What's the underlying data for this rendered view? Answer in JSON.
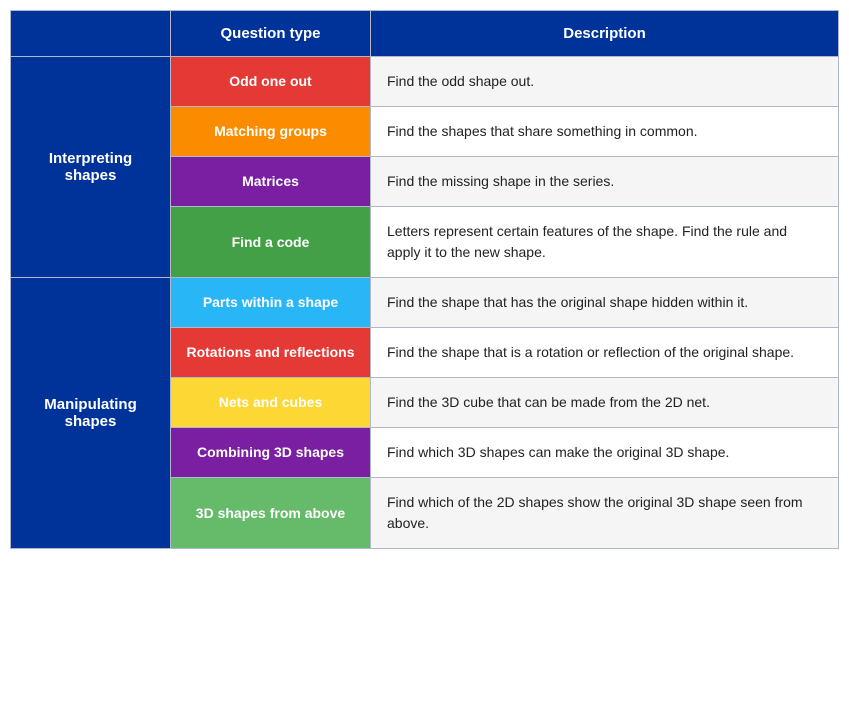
{
  "header": {
    "col1": "",
    "col2": "Question type",
    "col3": "Description"
  },
  "sections": [
    {
      "section_label": "Interpreting shapes",
      "section_rowspan": 4,
      "rows": [
        {
          "question_type": "Odd one out",
          "bg_class": "bg-red",
          "description": "Find the odd shape out.",
          "desc_alt": false
        },
        {
          "question_type": "Matching groups",
          "bg_class": "bg-orange",
          "description": "Find the shapes that share something in common.",
          "desc_alt": true
        },
        {
          "question_type": "Matrices",
          "bg_class": "bg-purple",
          "description": "Find the missing shape in the series.",
          "desc_alt": false
        },
        {
          "question_type": "Find a code",
          "bg_class": "bg-green-dark",
          "description": "Letters represent certain features of the shape. Find the rule and apply it to the new shape.",
          "desc_alt": true
        }
      ]
    },
    {
      "section_label": "Manipulating shapes",
      "section_rowspan": 5,
      "rows": [
        {
          "question_type": "Parts within a shape",
          "bg_class": "bg-cyan",
          "description": "Find the shape that has the original shape hidden within it.",
          "desc_alt": false
        },
        {
          "question_type": "Rotations and reflections",
          "bg_class": "bg-red2",
          "description": "Find the shape that is a rotation or reflection of the original shape.",
          "desc_alt": true
        },
        {
          "question_type": "Nets and cubes",
          "bg_class": "bg-yellow",
          "description": "Find the 3D cube that can be made from the 2D net.",
          "desc_alt": false
        },
        {
          "question_type": "Combining 3D shapes",
          "bg_class": "bg-purple2",
          "description": "Find which 3D shapes can make the original 3D shape.",
          "desc_alt": true
        },
        {
          "question_type": "3D shapes from above",
          "bg_class": "bg-green2",
          "description": "Find which of the 2D shapes show the original 3D shape seen from above.",
          "desc_alt": false
        }
      ]
    }
  ]
}
